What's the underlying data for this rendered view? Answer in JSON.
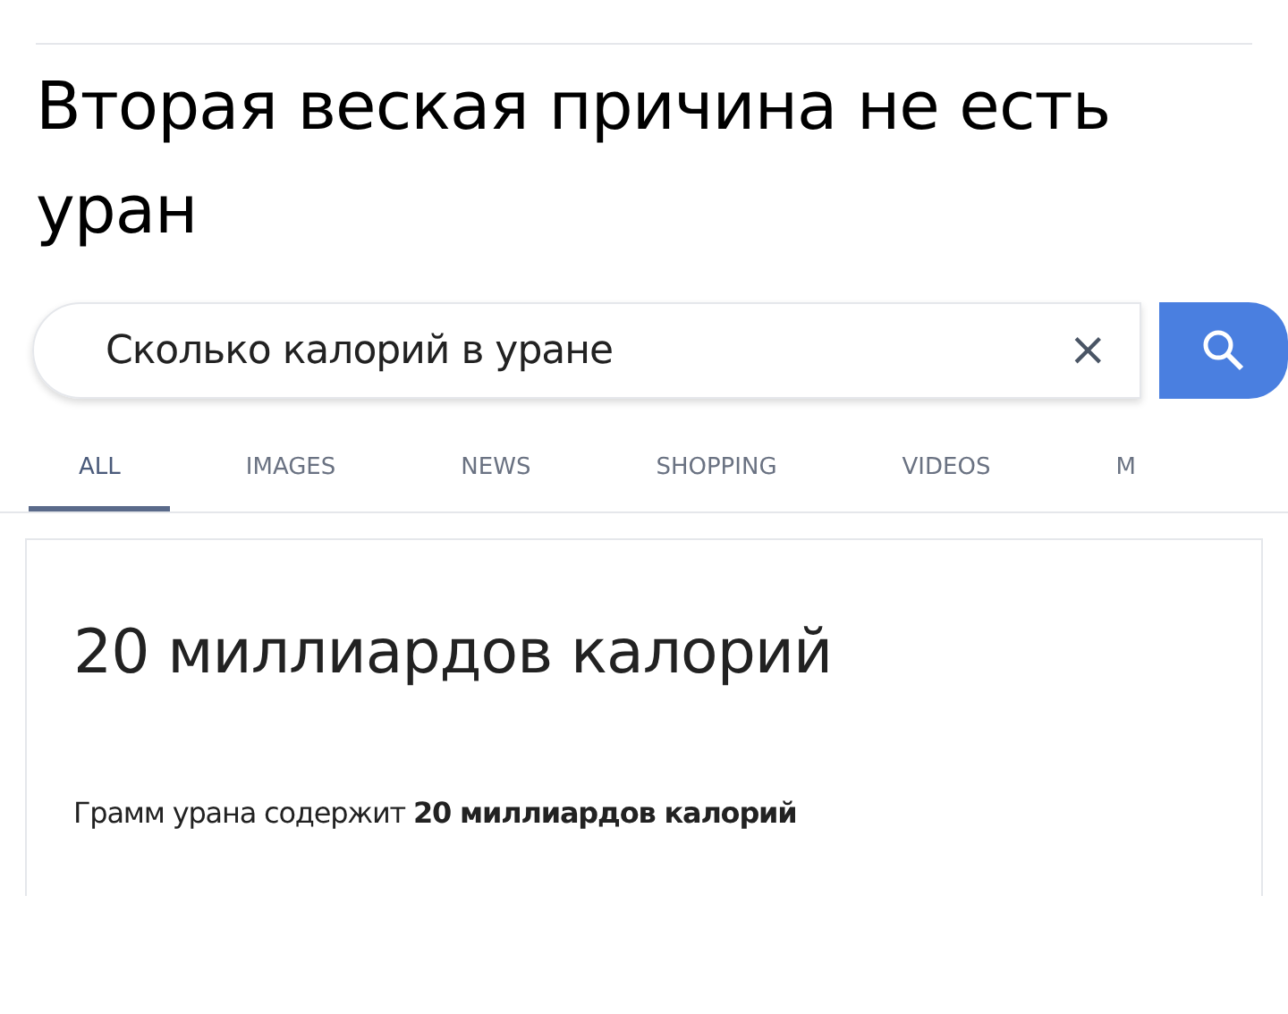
{
  "caption": "Вторая веская причина не есть уран",
  "search": {
    "value": "Сколько калорий в уране",
    "clear": "×"
  },
  "tabs": [
    {
      "label": "ALL",
      "selected": true
    },
    {
      "label": "IMAGES",
      "selected": false
    },
    {
      "label": "NEWS",
      "selected": false
    },
    {
      "label": "SHOPPING",
      "selected": false
    },
    {
      "label": "VIDEOS",
      "selected": false
    },
    {
      "label": "M",
      "selected": false
    }
  ],
  "answer": {
    "title": "20 миллиардов калорий",
    "text": "Грамм урана содержит **20 миллиардов калорий**"
  }
}
